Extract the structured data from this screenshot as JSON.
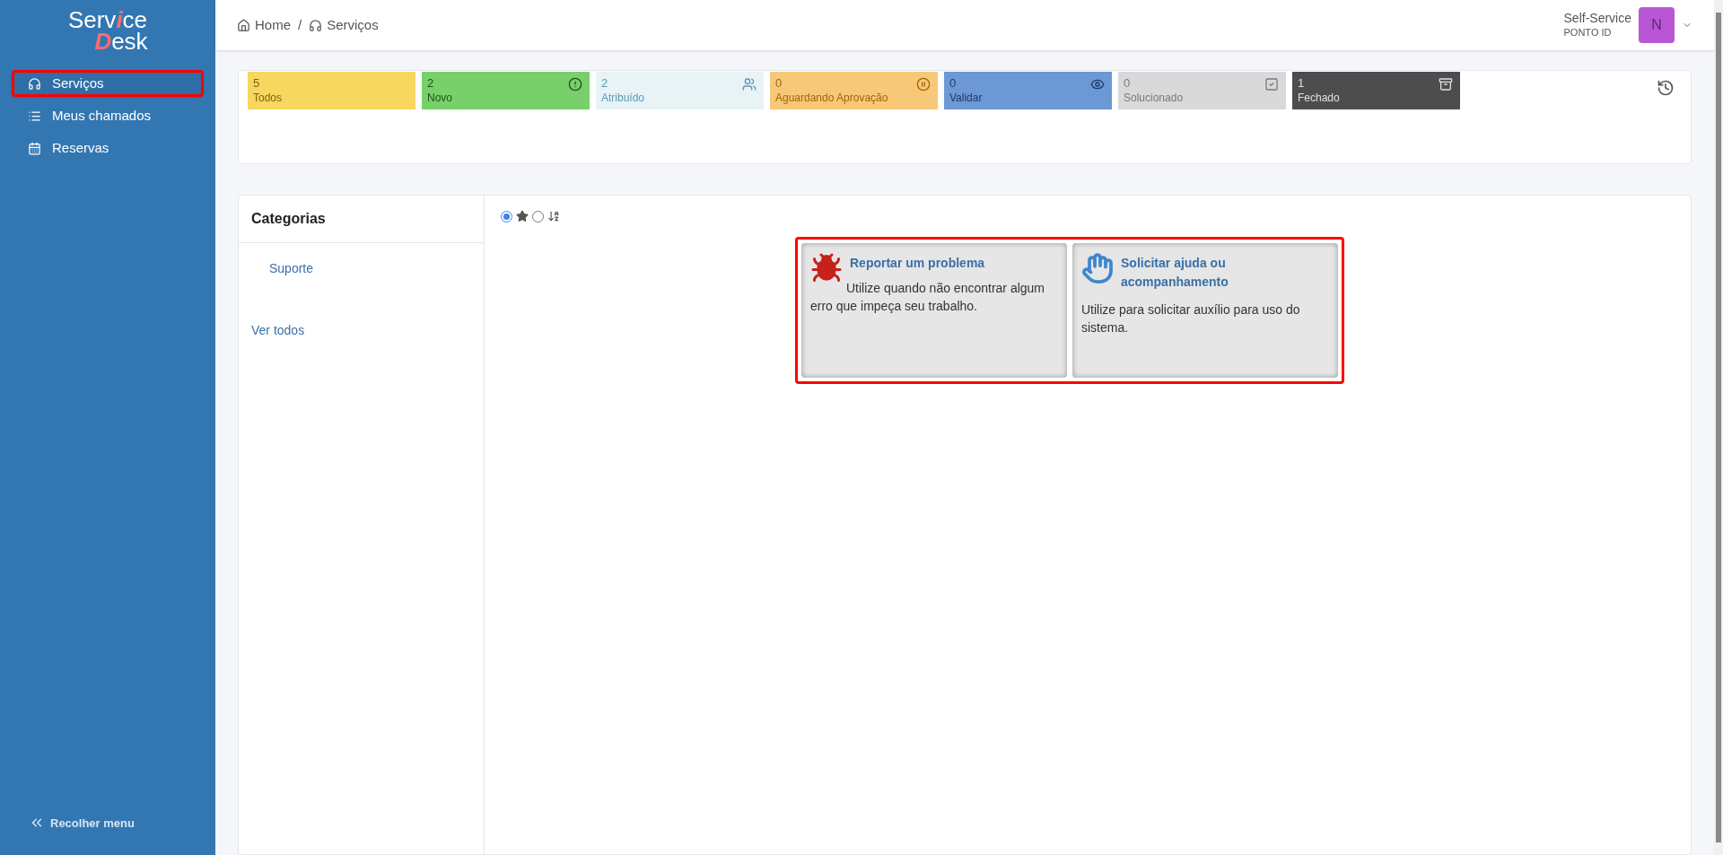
{
  "logo": [
    {
      "text": "Serv",
      "accent": false
    },
    {
      "text": "i",
      "accent": true
    },
    {
      "text": "ce",
      "accent": false
    },
    {
      "text": "D",
      "accent": true
    },
    {
      "text": "esk",
      "accent": false
    }
  ],
  "sidebar": {
    "items": [
      {
        "label": "Serviços",
        "kind": "headset",
        "selected": true,
        "highlighted": true
      },
      {
        "label": "Meus chamados",
        "kind": "list",
        "selected": false,
        "highlighted": false
      },
      {
        "label": "Reservas",
        "kind": "calendar",
        "selected": false,
        "highlighted": false
      }
    ],
    "collapse": "Recolher menu"
  },
  "breadcrumb": [
    {
      "label": "Home",
      "kind": "home"
    },
    {
      "label": "Serviços",
      "kind": "headset"
    }
  ],
  "breadcrumb_separator": "/",
  "user": {
    "name": "Self-Service",
    "org": "PONTO ID",
    "initial": "N"
  },
  "status_tiles": [
    {
      "count": "5",
      "label": "Todos",
      "kind": "none",
      "color": "#f7d75f"
    },
    {
      "count": "2",
      "label": "Novo",
      "kind": "alert",
      "color": "#78d06a"
    },
    {
      "count": "2",
      "label": "Atribuído",
      "kind": "users",
      "color": "#e8f3f6"
    },
    {
      "count": "0",
      "label": "Aguardando Aprovação",
      "kind": "pause",
      "color": "#f7c878"
    },
    {
      "count": "0",
      "label": "Validar",
      "kind": "eye",
      "color": "#6c98d6"
    },
    {
      "count": "0",
      "label": "Solucionado",
      "kind": "check",
      "color": "#d9d9d9"
    },
    {
      "count": "1",
      "label": "Fechado",
      "kind": "archive",
      "color": "#4d4d4d"
    }
  ],
  "categories": {
    "title": "Categorias",
    "items": [
      "Suporte"
    ],
    "see_all": "Ver todos"
  },
  "filters": [
    {
      "kind": "star",
      "selected": true
    },
    {
      "kind": "sort",
      "selected": false
    }
  ],
  "services_highlighted": true,
  "services": [
    {
      "kind": "bug",
      "title": "Reportar um problema",
      "description": "Utilize quando não encontrar algum erro que impeça seu trabalho.",
      "indent": true
    },
    {
      "kind": "hand",
      "title": "Solicitar ajuda ou acompanhamento",
      "description": "Utilize para solicitar auxílio para uso do sistema.",
      "indent": false
    }
  ]
}
